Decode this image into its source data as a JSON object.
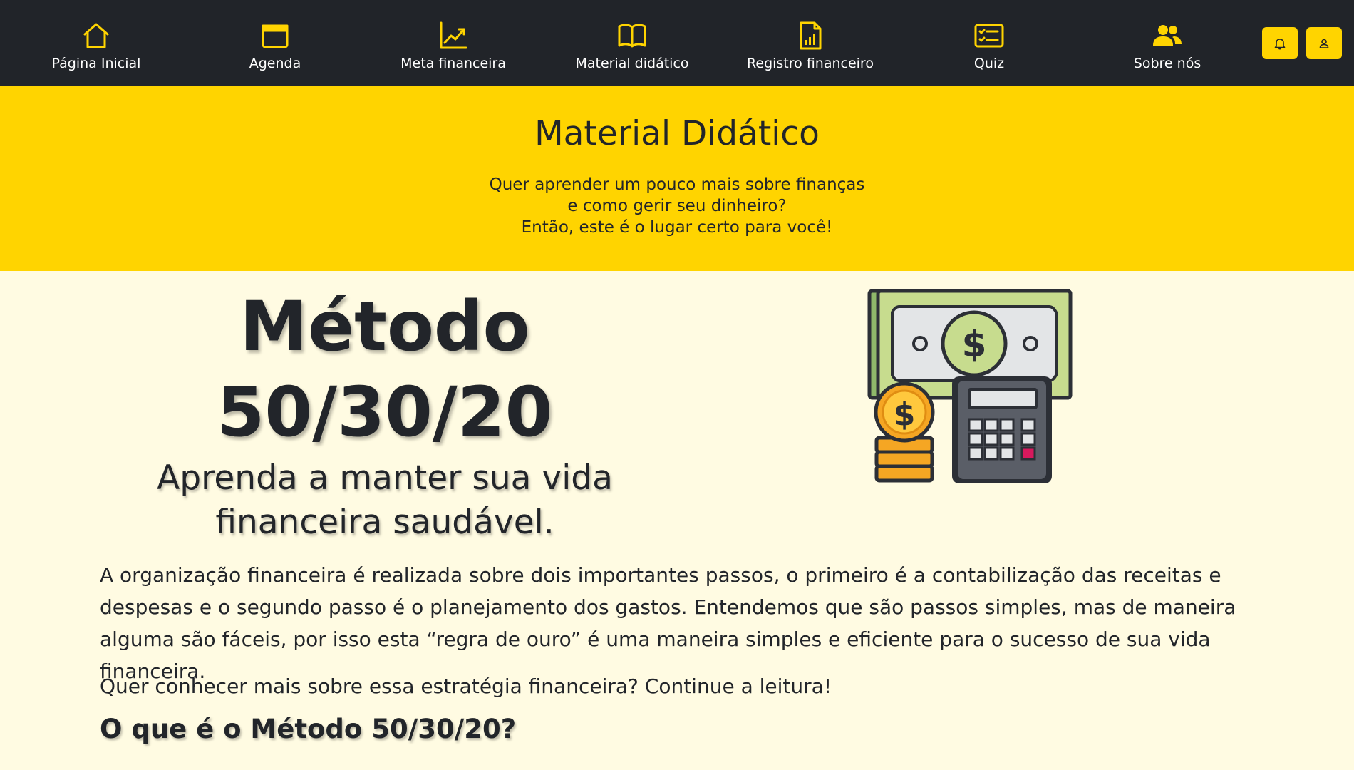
{
  "nav": {
    "items": [
      {
        "label": "Página Inicial",
        "icon": "home-icon"
      },
      {
        "label": "Agenda",
        "icon": "calendar-icon"
      },
      {
        "label": "Meta financeira",
        "icon": "trend-chart-icon"
      },
      {
        "label": "Material didático",
        "icon": "book-icon"
      },
      {
        "label": "Registro financeiro",
        "icon": "bar-report-icon"
      },
      {
        "label": "Quiz",
        "icon": "checklist-icon"
      },
      {
        "label": "Sobre nós",
        "icon": "users-icon"
      }
    ],
    "notifications_icon": "bell-icon",
    "profile_icon": "user-icon"
  },
  "hero": {
    "title": "Material Didático",
    "subtitle_lines": [
      "Quer aprender um pouco mais sobre finanças",
      "e como gerir seu dinheiro?",
      "Então, este é o lugar certo para você!"
    ]
  },
  "article": {
    "title_lines": [
      "Método",
      "50/30/20"
    ],
    "subtitle_lines": [
      "Aprenda a manter sua vida",
      "financeira saudável."
    ],
    "illustration": "money-calculator-illustration",
    "paragraphs": [
      "A organização financeira é realizada sobre dois importantes passos, o primeiro é a contabilização das receitas e despesas e o segundo passo é o planejamento dos gastos. Entendemos que são passos simples, mas de maneira alguma são fáceis, por isso esta “regra de ouro” é uma maneira simples e eficiente para o sucesso de sua vida financeira.",
      "Quer conhecer mais sobre essa estratégia financeira? Continue a leitura!"
    ],
    "section_heading": "O que é o Método 50/30/20?"
  },
  "colors": {
    "navbar": "#212429",
    "accent": "#ffd400",
    "page_background": "#fffbe2",
    "text": "#22252a"
  }
}
